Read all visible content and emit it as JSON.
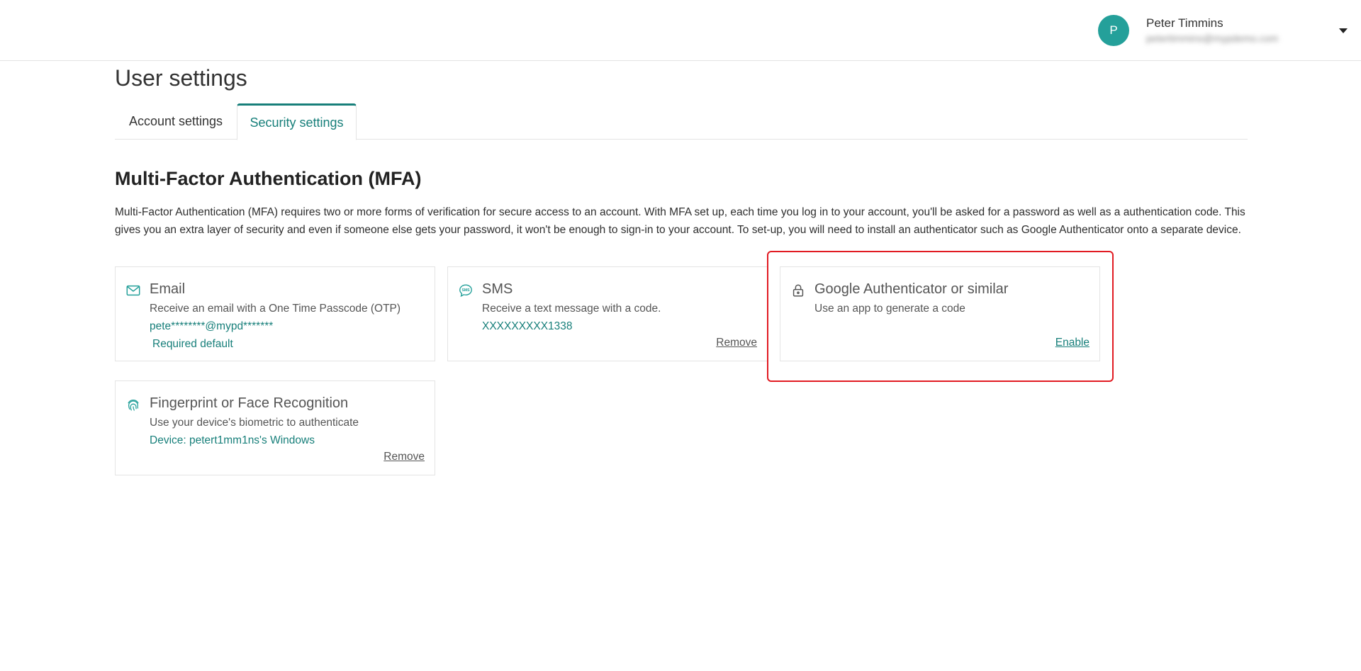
{
  "header": {
    "avatar_initial": "P",
    "user_name": "Peter Timmins",
    "user_email": "petertimmins@mypdemo.com"
  },
  "page": {
    "title": "User settings"
  },
  "tabs": [
    {
      "label": "Account settings",
      "active": false
    },
    {
      "label": "Security settings",
      "active": true
    }
  ],
  "mfa": {
    "title": "Multi-Factor Authentication (MFA)",
    "description": "Multi-Factor Authentication (MFA) requires two or more forms of verification for secure access to an account. With MFA set up, each time you log in to your account, you'll be asked for a password as well as a authentication code. This gives you an extra layer of security and even if someone else gets your password, it won't be enough to sign-in to your account. To set-up, you will need to install an authenticator such as Google Authenticator onto a separate device.",
    "methods": {
      "email": {
        "icon": "mail-icon",
        "title": "Email",
        "subtitle": "Receive an email with a One Time Passcode (OTP)",
        "value": "pete********@mypd*******",
        "badge": "Required default"
      },
      "sms": {
        "icon": "sms-icon",
        "title": "SMS",
        "subtitle": "Receive a text message with a code.",
        "value": "XXXXXXXXX1338",
        "action": "Remove"
      },
      "authenticator": {
        "icon": "lock-icon",
        "title": "Google Authenticator or similar",
        "subtitle": "Use an app to generate a code",
        "action": "Enable"
      },
      "biometric": {
        "icon": "fingerprint-icon",
        "title": "Fingerprint or Face Recognition",
        "subtitle": "Use your device's biometric to authenticate",
        "value": "Device: petert1mm1ns's Windows",
        "action": "Remove"
      }
    }
  },
  "colors": {
    "accent": "#177f7a",
    "avatar": "#24a09a",
    "highlight": "#e11b22"
  }
}
